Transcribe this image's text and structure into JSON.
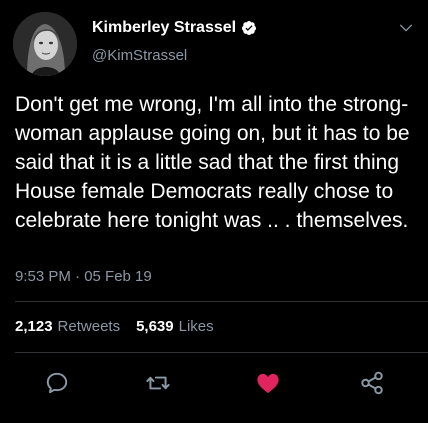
{
  "author": {
    "display_name": "Kimberley Strassel",
    "handle": "@KimStrassel",
    "verified": true
  },
  "tweet": {
    "text": "Don't get me wrong, I'm all into the strong-woman applause going on, but it has to be said that it is a little sad that the first thing House female Democrats really chose to celebrate here tonight was .. . themselves.",
    "timestamp": "9:53 PM · 05 Feb 19"
  },
  "stats": {
    "retweets_count": "2,123",
    "retweets_label": "Retweets",
    "likes_count": "5,639",
    "likes_label": "Likes"
  },
  "actions": {
    "reply_icon": "reply-icon",
    "retweet_icon": "retweet-icon",
    "like_icon": "heart-icon",
    "share_icon": "share-icon"
  },
  "colors": {
    "background": "#000000",
    "text_primary": "#ffffff",
    "text_secondary": "#8b98a5",
    "divider": "#2f3336",
    "like_active": "#e0245e",
    "verified": "#ffffff"
  }
}
